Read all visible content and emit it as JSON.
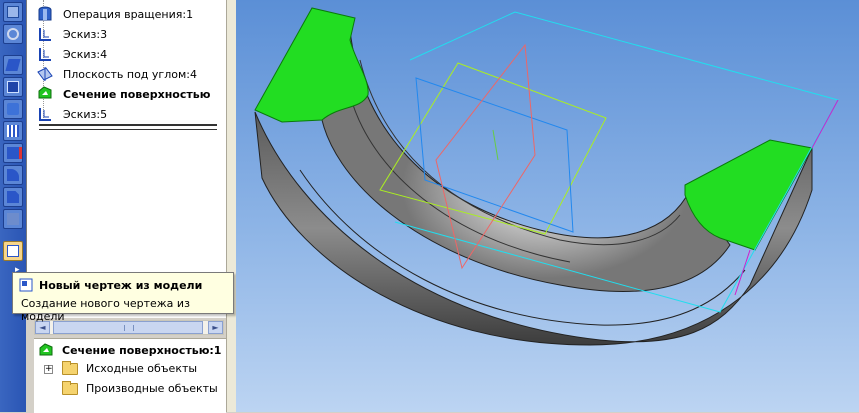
{
  "tree": {
    "items": [
      {
        "label": "Операция вращения:1",
        "icon": "revolve-icon"
      },
      {
        "label": "Эскиз:3",
        "icon": "sketch-icon"
      },
      {
        "label": "Эскиз:4",
        "icon": "sketch-icon"
      },
      {
        "label": "Плоскость под углом:4",
        "icon": "plane-icon"
      },
      {
        "label": "Сечение поверхностью",
        "icon": "section-icon"
      },
      {
        "label": "Эскиз:5",
        "icon": "sketch-icon"
      }
    ]
  },
  "tooltip": {
    "title": "Новый чертеж из модели",
    "description": "Создание нового чертежа из модели"
  },
  "props": {
    "title": "Сечение поверхностью:1",
    "children": [
      {
        "label": "Исходные объекты",
        "expander": "+"
      },
      {
        "label": "Производные объекты"
      }
    ]
  },
  "colors": {
    "face_green": "#22dd22",
    "body_gray": "#8a8a8a",
    "plane_cyan": "#22ddee",
    "plane_yellowgreen": "#aaee22",
    "plane_blue": "#2288ee",
    "plane_red": "#ee6666",
    "edge_magenta": "#cc22cc"
  }
}
